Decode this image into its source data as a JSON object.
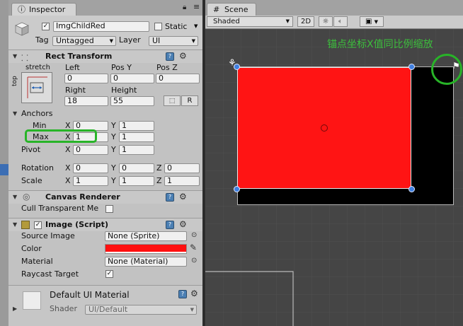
{
  "inspector_tab": {
    "label": "Inspector"
  },
  "scene_tab": {
    "label": "Scene"
  },
  "gameobject": {
    "name": "ImgChildRed",
    "static_label": "Static",
    "tag_label": "Tag",
    "tag_value": "Untagged",
    "layer_label": "Layer",
    "layer_value": "UI"
  },
  "rect_transform": {
    "title": "Rect Transform",
    "anchor_preset_top": "stretch",
    "anchor_preset_side": "top",
    "col1_label": "Left",
    "col2_label": "Pos Y",
    "col3_label": "Pos Z",
    "left": "0",
    "pos_y": "0",
    "pos_z": "0",
    "col4_label": "Right",
    "col5_label": "Height",
    "right": "18",
    "height": "55",
    "r_button": "R",
    "anchors_label": "Anchors",
    "min_label": "Min",
    "max_label": "Max",
    "pivot_label": "Pivot",
    "x_letter": "X",
    "y_letter": "Y",
    "z_letter": "Z",
    "min_x": "0",
    "min_y": "1",
    "max_x": "1",
    "max_y": "1",
    "pivot_x": "0",
    "pivot_y": "1",
    "rotation_label": "Rotation",
    "rot_x": "0",
    "rot_y": "0",
    "rot_z": "0",
    "scale_label": "Scale",
    "scale_x": "1",
    "scale_y": "1",
    "scale_z": "1"
  },
  "canvas_renderer": {
    "title": "Canvas Renderer",
    "cull_label": "Cull Transparent Me"
  },
  "image_script": {
    "title": "Image (Script)",
    "source_label": "Source Image",
    "source_value": "None (Sprite)",
    "color_label": "Color",
    "color_value": "#ff0f0f",
    "material_label": "Material",
    "material_value": "None (Material)",
    "raycast_label": "Raycast Target"
  },
  "default_material": {
    "name": "Default UI Material",
    "shader_label": "Shader",
    "shader_value": "UI/Default"
  },
  "scene_toolbar": {
    "shading_mode": "Shaded",
    "two_d": "2D"
  },
  "annotation": {
    "text": "锚点坐标X值同比例缩放",
    "color": "#3cbf3c"
  },
  "colors": {
    "red_image": "#ff1414",
    "black_rect": "#000000",
    "highlight_green": "#28b428",
    "handle_blue": "#3f7fe0"
  }
}
